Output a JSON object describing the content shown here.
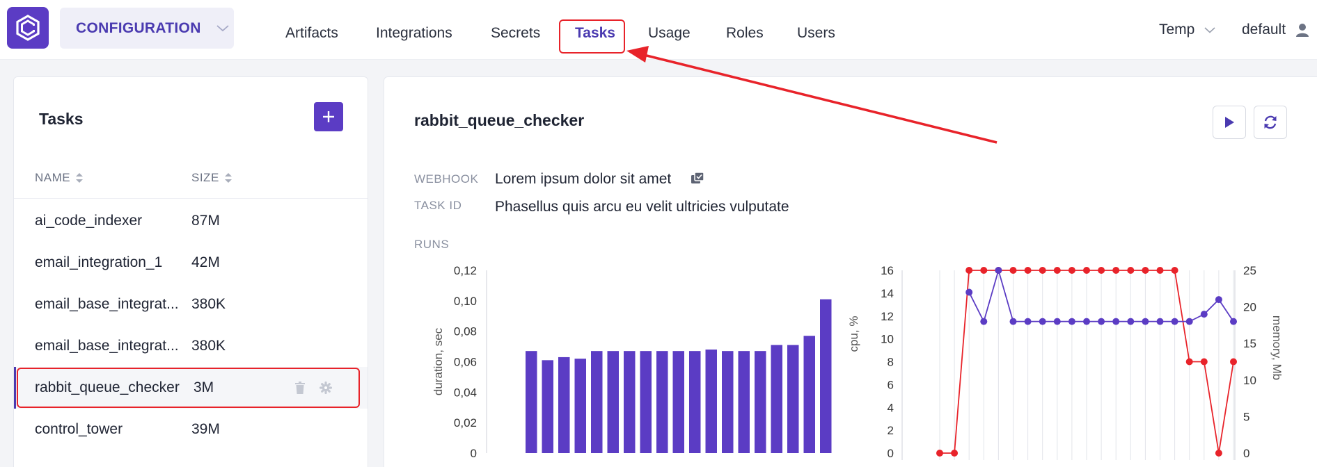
{
  "header": {
    "section_label": "CONFIGURATION",
    "nav": [
      "Artifacts",
      "Integrations",
      "Secrets",
      "Tasks",
      "Usage",
      "Roles",
      "Users"
    ],
    "active_nav": "Tasks",
    "environment": "Temp",
    "user": "default",
    "colors": {
      "accent": "#5b3cc4",
      "highlight": "#e8232a"
    }
  },
  "tasks_panel": {
    "title": "Tasks",
    "columns": {
      "name": "NAME",
      "size": "SIZE"
    },
    "rows": [
      {
        "name": "ai_code_indexer",
        "size": "87M"
      },
      {
        "name": "email_integration_1",
        "size": "42M"
      },
      {
        "name": "email_base_integrat...",
        "size": "380K"
      },
      {
        "name": "email_base_integrat...",
        "size": "380K"
      },
      {
        "name": "rabbit_queue_checker",
        "size": "3M"
      },
      {
        "name": "control_tower",
        "size": "39M"
      }
    ],
    "selected_index": 4
  },
  "detail": {
    "title": "rabbit_queue_checker",
    "webhook_label": "WEBHOOK",
    "webhook_value": "Lorem ipsum dolor sit amet",
    "task_id_label": "TASK ID",
    "task_id_value": "Phasellus quis arcu eu velit ultricies vulputate",
    "runs_label": "RUNS"
  },
  "chart_data": [
    {
      "type": "bar",
      "ylabel": "duration, sec",
      "ylim": [
        0,
        0.12
      ],
      "yticks": [
        "0",
        "0,02",
        "0,04",
        "0,06",
        "0,08",
        "0,10",
        "0,12"
      ],
      "values": [
        0.067,
        0.061,
        0.063,
        0.062,
        0.067,
        0.067,
        0.067,
        0.067,
        0.067,
        0.067,
        0.067,
        0.068,
        0.067,
        0.067,
        0.067,
        0.071,
        0.071,
        0.077,
        0.101
      ],
      "color": "#5b3cc4"
    },
    {
      "type": "line",
      "ylabel": "cpu, %",
      "y2label": "memory, Mb",
      "ylim": [
        0,
        16
      ],
      "y2lim": [
        0,
        25
      ],
      "yticks": [
        "0",
        "2",
        "4",
        "6",
        "8",
        "10",
        "12",
        "14",
        "16"
      ],
      "y2ticks": [
        "0",
        "5",
        "10",
        "15",
        "20",
        "25"
      ],
      "series": [
        {
          "axis": "left",
          "color": "#e8232a",
          "values": [
            0,
            0,
            16,
            16,
            16,
            16,
            16,
            16,
            16,
            16,
            16,
            16,
            16,
            16,
            16,
            16,
            16,
            8,
            8,
            0,
            8
          ]
        },
        {
          "axis": "right",
          "color": "#5b3cc4",
          "values": [
            null,
            null,
            22,
            18,
            25,
            18,
            18,
            18,
            18,
            18,
            18,
            18,
            18,
            18,
            18,
            18,
            18,
            18,
            19,
            21,
            18
          ]
        }
      ]
    }
  ]
}
